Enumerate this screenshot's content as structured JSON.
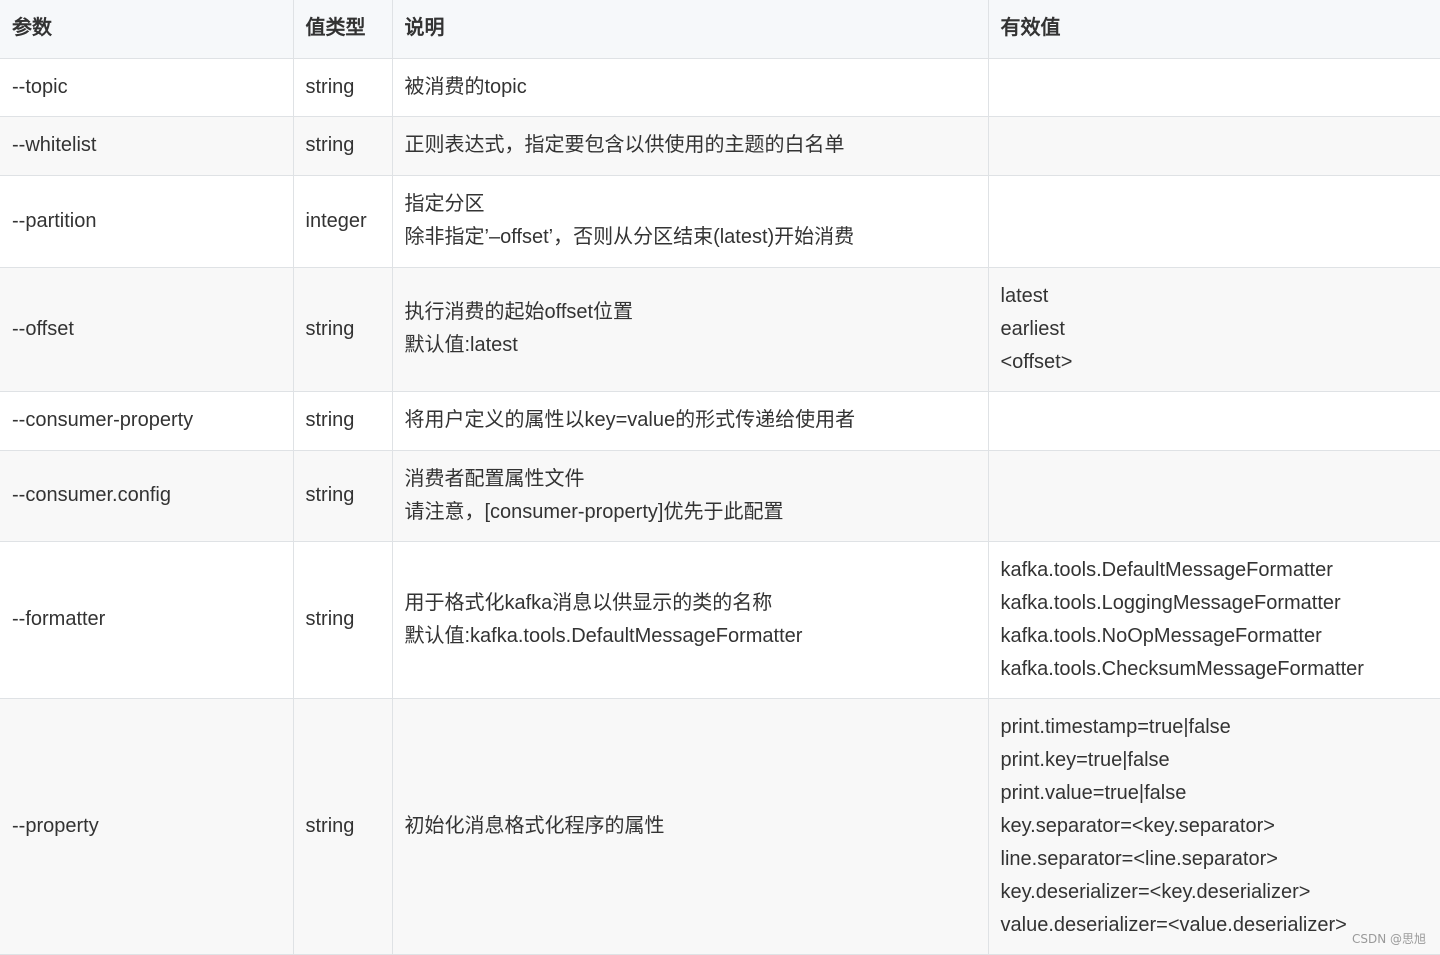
{
  "table": {
    "headers": [
      "参数",
      "值类型",
      "说明",
      "有效值"
    ],
    "rows": [
      {
        "param": "--topic",
        "type": "string",
        "desc": [
          "被消费的topic"
        ],
        "values": []
      },
      {
        "param": "--whitelist",
        "type": "string",
        "desc": [
          "正则表达式，指定要包含以供使用的主题的白名单"
        ],
        "values": []
      },
      {
        "param": "--partition",
        "type": "integer",
        "desc": [
          "指定分区",
          "除非指定’–offset’，否则从分区结束(latest)开始消费"
        ],
        "values": []
      },
      {
        "param": "--offset",
        "type": "string",
        "desc": [
          "执行消费的起始offset位置",
          "默认值:latest"
        ],
        "values": [
          "latest",
          "earliest",
          "<offset>"
        ]
      },
      {
        "param": "--consumer-property",
        "type": "string",
        "desc": [
          "将用户定义的属性以key=value的形式传递给使用者"
        ],
        "values": []
      },
      {
        "param": "--consumer.config",
        "type": "string",
        "desc": [
          "消费者配置属性文件",
          "请注意，[consumer-property]优先于此配置"
        ],
        "values": []
      },
      {
        "param": "--formatter",
        "type": "string",
        "desc": [
          "用于格式化kafka消息以供显示的类的名称",
          "默认值:kafka.tools.DefaultMessageFormatter"
        ],
        "values": [
          "kafka.tools.DefaultMessageFormatter",
          "kafka.tools.LoggingMessageFormatter",
          "kafka.tools.NoOpMessageFormatter",
          "kafka.tools.ChecksumMessageFormatter"
        ]
      },
      {
        "param": "--property",
        "type": "string",
        "desc": [
          "初始化消息格式化程序的属性"
        ],
        "values": [
          "print.timestamp=true|false",
          "print.key=true|false",
          "print.value=true|false",
          "key.separator=<key.separator>",
          "line.separator=<line.separator>",
          "key.deserializer=<key.deserializer>",
          "value.deserializer=<value.deserializer>"
        ]
      }
    ]
  },
  "watermark": "CSDN @思旭"
}
